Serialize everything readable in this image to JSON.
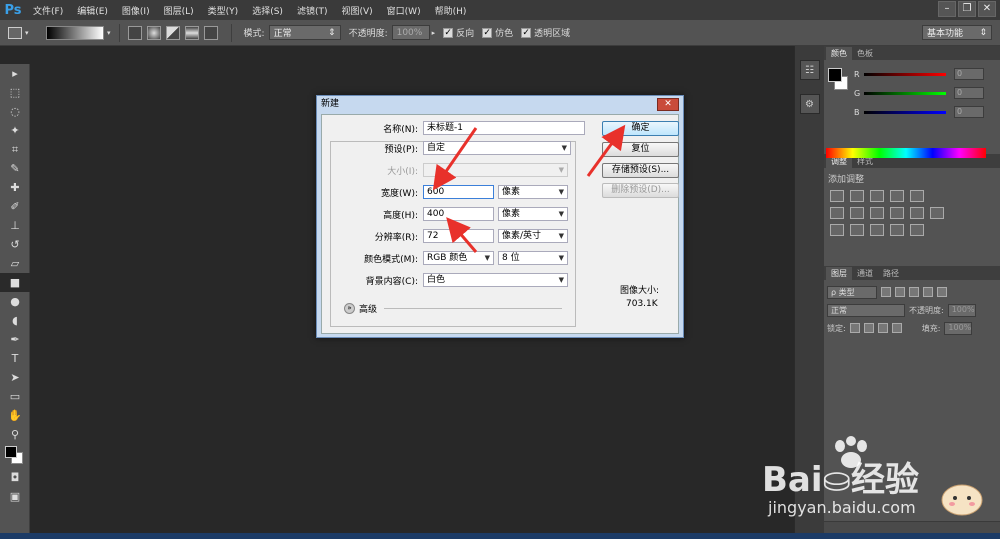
{
  "app": {
    "logo": "Ps",
    "menu": [
      "文件(F)",
      "编辑(E)",
      "图像(I)",
      "图层(L)",
      "类型(Y)",
      "选择(S)",
      "滤镜(T)",
      "视图(V)",
      "窗口(W)",
      "帮助(H)"
    ],
    "window_controls": [
      "–",
      "❐",
      "✕"
    ]
  },
  "options_bar": {
    "mode_label": "模式:",
    "mode_value": "正常",
    "opacity_label": "不透明度:",
    "opacity_value": "100%",
    "reverse_label": "反向",
    "dither_label": "仿色",
    "transparency_label": "透明区域",
    "workspace_value": "基本功能"
  },
  "panels": {
    "color_tabs": [
      "颜色",
      "色板"
    ],
    "color_labels": [
      "R",
      "G",
      "B"
    ],
    "color_values": [
      "0",
      "0",
      "0"
    ],
    "adjust_tabs": [
      "调整",
      "样式"
    ],
    "adjust_title": "添加调整",
    "layers_tabs": [
      "图层",
      "通道",
      "路径"
    ],
    "layer_filter": "ρ 类型",
    "blend_mode": "正常",
    "opacity_label": "不透明度:",
    "opacity_value": "100%",
    "lock_label": "锁定:",
    "fill_label": "填充:",
    "fill_value": "100%"
  },
  "dialog": {
    "title": "新建",
    "close": "✕",
    "name_label": "名称(N):",
    "name_value": "未标题-1",
    "preset_label": "预设(P):",
    "preset_value": "自定",
    "size_label": "大小(I):",
    "size_value": "",
    "width_label": "宽度(W):",
    "width_value": "600",
    "width_unit": "像素",
    "height_label": "高度(H):",
    "height_value": "400",
    "height_unit": "像素",
    "resolution_label": "分辨率(R):",
    "resolution_value": "72",
    "resolution_unit": "像素/英寸",
    "color_mode_label": "颜色模式(M):",
    "color_mode_value": "RGB 颜色",
    "bit_depth_value": "8 位",
    "background_label": "背景内容(C):",
    "background_value": "白色",
    "advanced_label": "高级",
    "ok_button": "确定",
    "reset_button": "复位",
    "save_preset_button": "存储预设(S)...",
    "delete_preset_button": "删除预设(D)...",
    "image_size_label": "图像大小:",
    "image_size_value": "703.1K"
  },
  "watermark": {
    "brand": "Bai⛀经验",
    "url": "jingyan.baidu.com"
  },
  "colors": {
    "dialog_frame": "#c6d9ef",
    "annotation_arrow": "#e8312b",
    "ps_blue": "#3aa0e8"
  }
}
